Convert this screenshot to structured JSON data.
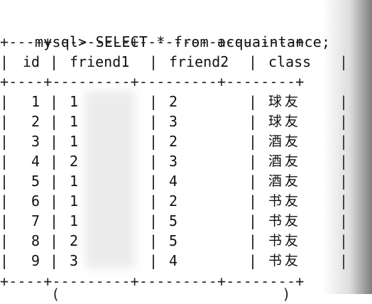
{
  "terminal": {
    "prompt": "mysql>",
    "command": "SELECT * from acquaintance;"
  },
  "table": {
    "border": "+----+---------+---------+--------+",
    "columns": [
      "id",
      "friend1",
      "friend2",
      "class"
    ],
    "rows": [
      {
        "id": "1",
        "friend1": "1",
        "friend2": "2",
        "class": "球友"
      },
      {
        "id": "2",
        "friend1": "1",
        "friend2": "3",
        "class": "球友"
      },
      {
        "id": "3",
        "friend1": "1",
        "friend2": "2",
        "class": "酒友"
      },
      {
        "id": "4",
        "friend1": "2",
        "friend2": "3",
        "class": "酒友"
      },
      {
        "id": "5",
        "friend1": "1",
        "friend2": "4",
        "class": "酒友"
      },
      {
        "id": "6",
        "friend1": "1",
        "friend2": "2",
        "class": "书友"
      },
      {
        "id": "7",
        "friend1": "1",
        "friend2": "5",
        "class": "书友"
      },
      {
        "id": "8",
        "friend1": "2",
        "friend2": "5",
        "class": "书友"
      },
      {
        "id": "9",
        "friend1": "3",
        "friend2": "4",
        "class": "书友"
      }
    ]
  },
  "footer_partial": "      (                          )"
}
